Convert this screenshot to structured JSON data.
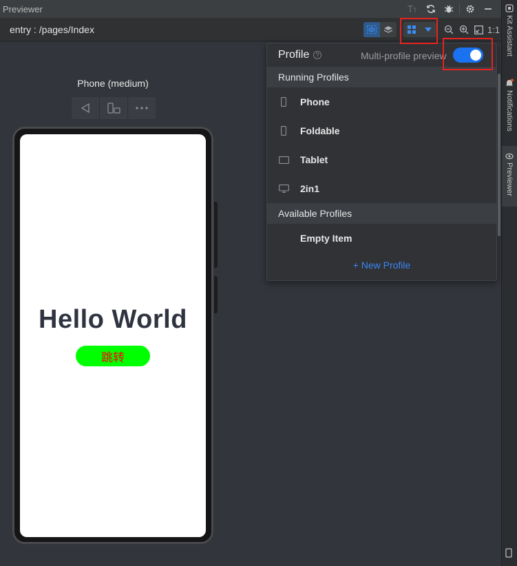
{
  "window": {
    "title": "Previewer"
  },
  "toolbar": {
    "route": "entry : /pages/Index",
    "ratio_label": "1:1"
  },
  "side_tabs": [
    {
      "label": "Kit Assistant"
    },
    {
      "label": "Notifications"
    },
    {
      "label": "Previewer"
    }
  ],
  "device": {
    "name": "Phone (medium)",
    "screen": {
      "hello_text": "Hello World",
      "button_label": "跳转"
    }
  },
  "profile_panel": {
    "title": "Profile",
    "multi_profile_label": "Multi-profile preview",
    "multi_profile_enabled": true,
    "running_header": "Running Profiles",
    "running": [
      {
        "label": "Phone",
        "icon": "phone-icon"
      },
      {
        "label": "Foldable",
        "icon": "foldable-icon"
      },
      {
        "label": "Tablet",
        "icon": "tablet-icon"
      },
      {
        "label": "2in1",
        "icon": "monitor-icon"
      }
    ],
    "available_header": "Available Profiles",
    "available": [
      {
        "label": "Empty Item"
      }
    ],
    "new_profile_label": "+ New Profile"
  },
  "colors": {
    "accent": "#1a72f0",
    "highlight": "#e8231f",
    "link": "#3b86f5",
    "button_bg": "#00ff00",
    "button_text": "#ff0000"
  }
}
